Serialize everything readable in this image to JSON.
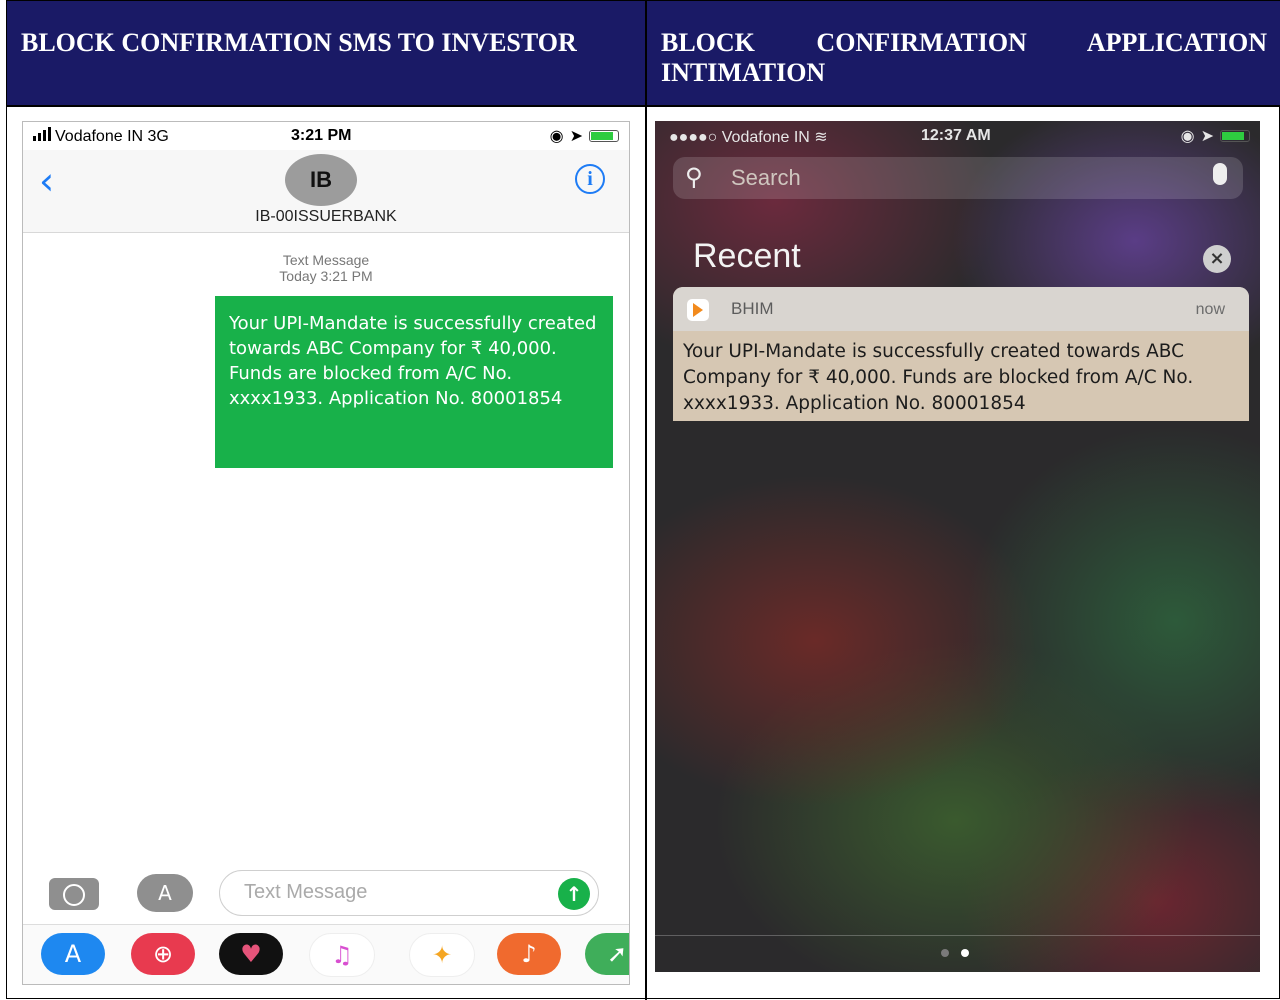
{
  "headers": {
    "left": "BLOCK CONFIRMATION SMS TO INVESTOR",
    "right": "BLOCK CONFIRMATION APPLICATION INTIMATION"
  },
  "sms_screen": {
    "status": {
      "carrier": "Vodafone IN  3G",
      "time": "3:21 PM"
    },
    "avatar_initials": "IB",
    "contact_name": "IB-00ISSUERBANK",
    "message_meta": {
      "type": "Text Message",
      "timestamp": "Today 3:21 PM"
    },
    "message_text": "Your UPI-Mandate is successfully created towards ABC Company for ₹ 40,000. Funds are blocked from A/C No. xxxx1933. Application No. 80001854",
    "composer_placeholder": "Text Message",
    "dock_icons": [
      "app-store-icon",
      "search-globe-icon",
      "heart-icon",
      "music-icon",
      "photos-icon",
      "guitar-icon",
      "maps-icon"
    ],
    "colors": {
      "bubble": "#18b14a",
      "accent": "#1e7cf5"
    }
  },
  "notification_screen": {
    "status": {
      "carrier": "Vodafone IN",
      "time": "12:37 AM"
    },
    "search_placeholder": "Search",
    "section_title": "Recent",
    "notification": {
      "app_name": "BHIM",
      "time": "now",
      "text": "Your UPI-Mandate is successfully created towards ABC Company for ₹ 40,000. Funds are blocked from A/C No. xxxx1933. Application No. 80001854"
    }
  }
}
